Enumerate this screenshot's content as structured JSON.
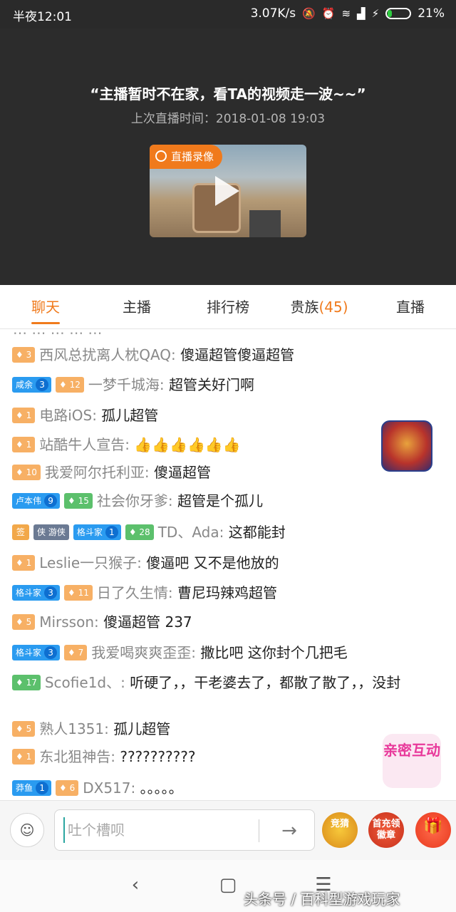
{
  "status": {
    "time": "半夜12:01",
    "speed": "3.07K/s",
    "battery": "21%",
    "battery_level": 0.21
  },
  "video": {
    "title": "“主播暂时不在家，看TA的视频走一波~~”",
    "last_live": "上次直播时间：2018-01-08  19:03",
    "tag": "直播录像"
  },
  "tabs": [
    {
      "label": "聊天"
    },
    {
      "label": "主播"
    },
    {
      "label": "排行榜"
    },
    {
      "label": "贵族",
      "count": "(45)"
    },
    {
      "label": "直播"
    }
  ],
  "chat": {
    "partial": "… … … … …",
    "messages": [
      {
        "badges": [
          {
            "t": "lv",
            "text": "3"
          }
        ],
        "user": "西风总扰离人枕QAQ:",
        "text": " 傻逼超管傻逼超管"
      },
      {
        "badges": [
          {
            "t": "fan",
            "text": "咸余",
            "n": "3"
          },
          {
            "t": "lv",
            "text": "12"
          }
        ],
        "user": "一梦千城海:",
        "text": " 超管关好门啊"
      },
      {
        "badges": [
          {
            "t": "lv",
            "text": "1"
          }
        ],
        "user": "电路iOS:",
        "text": " 孤儿超管"
      },
      {
        "badges": [
          {
            "t": "lv",
            "text": "1"
          }
        ],
        "user": "站酷牛人宣告:",
        "text": " 👍👍👍👍👍👍"
      },
      {
        "badges": [
          {
            "t": "lv",
            "text": "10"
          }
        ],
        "user": "我爱阿尔托利亚:",
        "text": " 傻逼超管"
      },
      {
        "badges": [
          {
            "t": "fan",
            "text": "卢本伟",
            "n": "9"
          },
          {
            "t": "lv-g",
            "text": "15"
          }
        ],
        "user": "社会你牙爹:",
        "text": " 超管是个孤儿"
      },
      {
        "badges": [
          {
            "t": "sign",
            "text": "签"
          },
          {
            "t": "knight",
            "text": "侠 游侠"
          },
          {
            "t": "fan",
            "text": "格斗家",
            "n": "1"
          },
          {
            "t": "lv-g",
            "text": "28"
          }
        ],
        "user": "TD、Ada:",
        "text": " 这都能封"
      },
      {
        "badges": [
          {
            "t": "lv",
            "text": "1"
          }
        ],
        "user": "Leslie一只猴子:",
        "text": " 傻逼吧 又不是他放的"
      },
      {
        "badges": [
          {
            "t": "fan",
            "text": "格斗家",
            "n": "3"
          },
          {
            "t": "lv",
            "text": "11"
          }
        ],
        "user": "日了久生情:",
        "text": " 曹尼玛辣鸡超管"
      },
      {
        "badges": [
          {
            "t": "lv",
            "text": "5"
          }
        ],
        "user": "Mirsson:",
        "text": " 傻逼超管 237"
      },
      {
        "badges": [
          {
            "t": "fan",
            "text": "格斗家",
            "n": "3"
          },
          {
            "t": "lv",
            "text": "7"
          }
        ],
        "user": "我爱喝爽爽歪歪:",
        "text": " 撒比吧 这你封个几把毛"
      },
      {
        "badges": [
          {
            "t": "lv-g",
            "text": "17"
          }
        ],
        "user": "Scofie1d、:",
        "text": " 听硬了，，干老婆去了，都散了散了，，没封"
      },
      {
        "badges": [
          {
            "t": "lv",
            "text": "5"
          }
        ],
        "user": "熟人1351:",
        "text": " 孤儿超管"
      },
      {
        "badges": [
          {
            "t": "lv",
            "text": "1"
          }
        ],
        "user": "东北狙神告:",
        "text": " ??????????"
      },
      {
        "badges": [
          {
            "t": "fan",
            "text": "莽鱼",
            "n": "1"
          },
          {
            "t": "lv",
            "text": "6"
          }
        ],
        "user": "DX517:",
        "text": " 。。。。。"
      }
    ]
  },
  "floats": {
    "interact": "亲密互动"
  },
  "input": {
    "placeholder": "吐个槽呗",
    "send": "→"
  },
  "gifts": [
    {
      "label": "竞猜"
    },
    {
      "label": "首充领徽章"
    },
    {
      "label": "🎁"
    }
  ],
  "watermark": "头条号 / 百科型游戏玩家"
}
